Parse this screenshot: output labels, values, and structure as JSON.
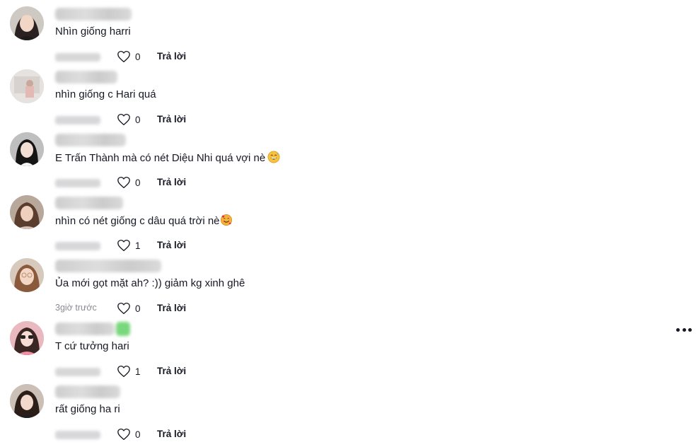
{
  "reply_label": "Trả lời",
  "comments": [
    {
      "text": "Nhìn giống harri",
      "time": "",
      "likes": "0",
      "emoji": ""
    },
    {
      "text": "nhìn giống c Hari quá",
      "time": "",
      "likes": "0",
      "emoji": ""
    },
    {
      "text": "E Trấn Thành mà có nét Diệu Nhi quá vợi nè",
      "time": "",
      "likes": "0",
      "emoji": "grinning-sweat-emoji"
    },
    {
      "text": "nhìn có nét giống c dâu quá trời nè",
      "time": "",
      "likes": "1",
      "emoji": "smiling-hearts-emoji"
    },
    {
      "text": "Ủa mới gọt mặt ah? :)) giảm kg xinh ghê",
      "time": "3giờ trước",
      "likes": "0",
      "emoji": ""
    },
    {
      "text": "T cứ tưởng hari",
      "time": "",
      "likes": "1",
      "emoji": ""
    },
    {
      "text": "rất giống ha ri",
      "time": "",
      "likes": "0",
      "emoji": ""
    }
  ],
  "icons": {
    "like": "heart-outline-icon",
    "more": "more-horizontal-icon"
  },
  "colors": {
    "text": "#161823",
    "secondary": "#8a8b91"
  }
}
